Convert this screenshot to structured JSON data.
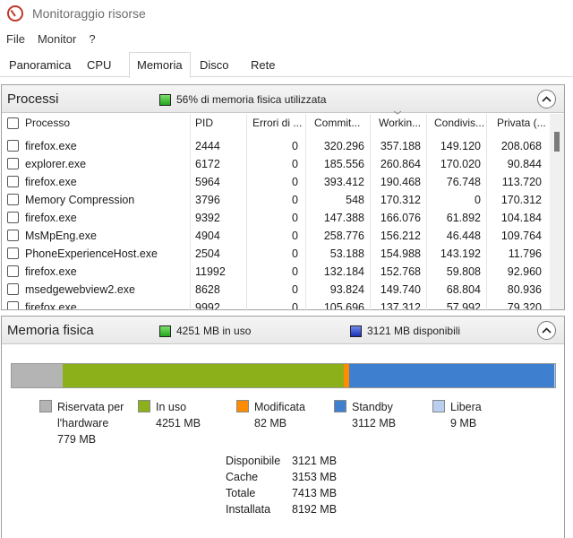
{
  "window": {
    "title": "Monitoraggio risorse"
  },
  "menu": [
    "File",
    "Monitor",
    "?"
  ],
  "tabs": [
    "Panoramica",
    "CPU",
    "Memoria",
    "Disco",
    "Rete"
  ],
  "processi": {
    "title": "Processi",
    "status": "56% di memoria fisica utilizzata",
    "columns": [
      "Processo",
      "PID",
      "Errori di ...",
      "Commit...",
      "Workin...",
      "Condivis...",
      "Privata (..."
    ],
    "rows": [
      {
        "processo": "firefox.exe",
        "pid": "2444",
        "errori": "0",
        "commit": "320.296",
        "working": "357.188",
        "condivis": "149.120",
        "privata": "208.068"
      },
      {
        "processo": "explorer.exe",
        "pid": "6172",
        "errori": "0",
        "commit": "185.556",
        "working": "260.864",
        "condivis": "170.020",
        "privata": "90.844"
      },
      {
        "processo": "firefox.exe",
        "pid": "5964",
        "errori": "0",
        "commit": "393.412",
        "working": "190.468",
        "condivis": "76.748",
        "privata": "113.720"
      },
      {
        "processo": "Memory Compression",
        "pid": "3796",
        "errori": "0",
        "commit": "548",
        "working": "170.312",
        "condivis": "0",
        "privata": "170.312"
      },
      {
        "processo": "firefox.exe",
        "pid": "9392",
        "errori": "0",
        "commit": "147.388",
        "working": "166.076",
        "condivis": "61.892",
        "privata": "104.184"
      },
      {
        "processo": "MsMpEng.exe",
        "pid": "4904",
        "errori": "0",
        "commit": "258.776",
        "working": "156.212",
        "condivis": "46.448",
        "privata": "109.764"
      },
      {
        "processo": "PhoneExperienceHost.exe",
        "pid": "2504",
        "errori": "0",
        "commit": "53.188",
        "working": "154.988",
        "condivis": "143.192",
        "privata": "11.796"
      },
      {
        "processo": "firefox.exe",
        "pid": "11992",
        "errori": "0",
        "commit": "132.184",
        "working": "152.768",
        "condivis": "59.808",
        "privata": "92.960"
      },
      {
        "processo": "msedgewebview2.exe",
        "pid": "8628",
        "errori": "0",
        "commit": "93.824",
        "working": "149.740",
        "condivis": "68.804",
        "privata": "80.936"
      },
      {
        "processo": "firefox.exe",
        "pid": "9992",
        "errori": "0",
        "commit": "105.696",
        "working": "137.312",
        "condivis": "57.992",
        "privata": "79.320"
      }
    ]
  },
  "memoria": {
    "title": "Memoria fisica",
    "in_uso": "4251 MB in uso",
    "disponibili": "3121 MB disponibili",
    "bar_mb": [
      779,
      4251,
      82,
      3112,
      9
    ],
    "legend": [
      {
        "line1": "Riservata per",
        "line2": "l'hardware",
        "line3": "779 MB",
        "color": "#b4b4b4"
      },
      {
        "line1": "In uso",
        "line2": "4251 MB",
        "line3": "",
        "color": "#8bb01a"
      },
      {
        "line1": "Modificata",
        "line2": "82 MB",
        "line3": "",
        "color": "#ff8c00"
      },
      {
        "line1": "Standby",
        "line2": "3112 MB",
        "line3": "",
        "color": "#3f7fd0"
      },
      {
        "line1": "Libera",
        "line2": "9 MB",
        "line3": "",
        "color": "#b8cff0"
      }
    ],
    "stats": [
      {
        "label": "Disponibile",
        "value": "3121 MB"
      },
      {
        "label": "Cache",
        "value": "3153 MB"
      },
      {
        "label": "Totale",
        "value": "7413 MB"
      },
      {
        "label": "Installata",
        "value": "8192 MB"
      }
    ]
  }
}
